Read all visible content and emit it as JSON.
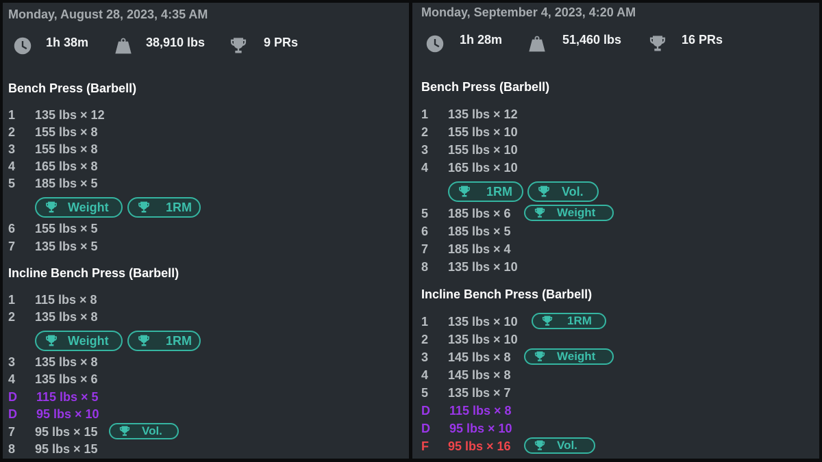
{
  "left": {
    "date": "Monday, August 28, 2023, 4:35 AM",
    "stats": {
      "duration": "1h 38m",
      "volume": "38,910 lbs",
      "prs": "9 PRs"
    },
    "ex1": {
      "title": "Bench Press (Barbell)",
      "s1n": "1",
      "s1": "135 lbs × 12",
      "s2n": "2",
      "s2": "155 lbs × 8",
      "s3n": "3",
      "s3": "155 lbs × 8",
      "s4n": "4",
      "s4": "165 lbs × 8",
      "s5n": "5",
      "s5": "185 lbs × 5",
      "b1": "Weight",
      "b2": "1RM",
      "s6n": "6",
      "s6": "155 lbs × 5",
      "s7n": "7",
      "s7": "135 lbs × 5"
    },
    "ex2": {
      "title": "Incline Bench Press (Barbell)",
      "s1n": "1",
      "s1": "115 lbs × 8",
      "s2n": "2",
      "s2": "135 lbs × 8",
      "b1": "Weight",
      "b2": "1RM",
      "s3n": "3",
      "s3": "135 lbs × 8",
      "s4n": "4",
      "s4": "135 lbs × 6",
      "d1n": "D",
      "d1": "115 lbs × 5",
      "d2n": "D",
      "d2": "95 lbs × 10",
      "s7n": "7",
      "s7": "95 lbs × 15",
      "b3": "Vol.",
      "s8n": "8",
      "s8": "95 lbs × 15"
    }
  },
  "right": {
    "date": "Monday, September 4, 2023, 4:20 AM",
    "stats": {
      "duration": "1h 28m",
      "volume": "51,460 lbs",
      "prs": "16 PRs"
    },
    "ex1": {
      "title": "Bench Press (Barbell)",
      "s1n": "1",
      "s1": "135 lbs × 12",
      "s2n": "2",
      "s2": "155 lbs × 10",
      "s3n": "3",
      "s3": "155 lbs × 10",
      "s4n": "4",
      "s4": "165 lbs × 10",
      "b1": "1RM",
      "b2": "Vol.",
      "s5n": "5",
      "s5": "185 lbs × 6",
      "b3": "Weight",
      "s6n": "6",
      "s6": "185 lbs × 5",
      "s7n": "7",
      "s7": "185 lbs × 4",
      "s8n": "8",
      "s8": "135 lbs × 10"
    },
    "ex2": {
      "title": "Incline Bench Press (Barbell)",
      "s1n": "1",
      "s1": "135 lbs × 10",
      "b1": "1RM",
      "s2n": "2",
      "s2": "135 lbs × 10",
      "s3n": "3",
      "s3": "145 lbs × 8",
      "b2": "Weight",
      "s4n": "4",
      "s4": "145 lbs × 8",
      "s5n": "5",
      "s5": "135 lbs × 7",
      "d1n": "D",
      "d1": "115 lbs × 8",
      "d2n": "D",
      "d2": "95 lbs × 10",
      "fn": "F",
      "f": "95 lbs × 16",
      "b3": "Vol."
    }
  },
  "icons": {
    "duration": "clock-icon",
    "volume": "weight-icon",
    "prs": "trophy-icon",
    "badge": "trophy-icon"
  },
  "colors": {
    "panel": "#272c31",
    "accent": "#3cbfab",
    "drop_set": "#9a36e8",
    "failure_set": "#f1464b"
  }
}
